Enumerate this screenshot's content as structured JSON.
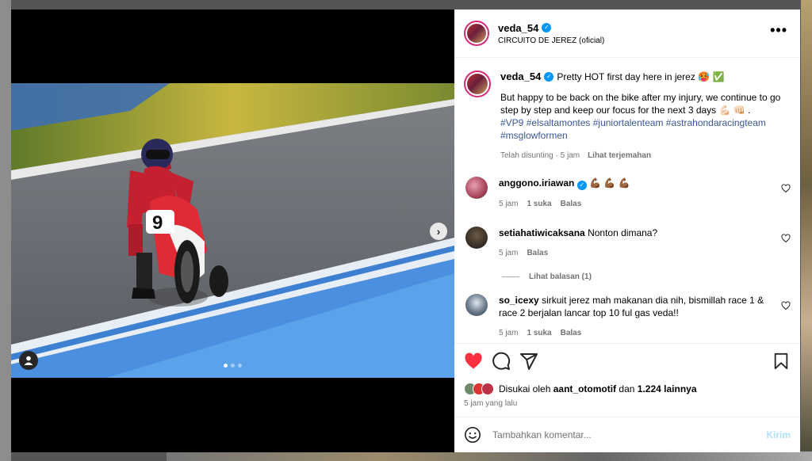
{
  "post": {
    "author": "veda_54",
    "location": "CIRCUITO DE JEREZ (oficial)",
    "more_label": "•••",
    "carousel": {
      "pages": 3,
      "current": 1
    }
  },
  "caption": {
    "author": "veda_54",
    "first_line": "Pretty HOT first day here in jerez 🥵 ✅",
    "body": "But happy to be back on the bike after my injury, we continue to go step by step and keep our focus for the next 3 days 💪🏻 👊🏻 .",
    "hashtags": "#VP9 #elsaltamontes #juniortalenteam #astrahondaracingteam #msglowformen",
    "edited": "Telah disunting · 5 jam",
    "translate": "Lihat terjemahan"
  },
  "comments": [
    {
      "user": "anggono.iriawan",
      "verified": true,
      "text": "💪🏾 💪🏾 💪🏾",
      "time": "5 jam",
      "likes": "1 suka",
      "reply": "Balas",
      "avatar_color": "#a8445a"
    },
    {
      "user": "setiahatiwicaksana",
      "verified": false,
      "text": "Nonton dimana?",
      "time": "5 jam",
      "likes": "",
      "reply": "Balas",
      "avatar_color": "#3a3128"
    },
    {
      "user": "so_icexy",
      "verified": false,
      "text": "sirkuit jerez mah makanan dia nih, bismillah race 1 & race 2 berjalan lancar top 10 ful gas veda!!",
      "time": "5 jam",
      "likes": "1 suka",
      "reply": "Balas",
      "avatar_color": "#6a7a8a"
    }
  ],
  "view_replies": "Lihat balasan (1)",
  "likes": {
    "prefix": "Disukai oleh",
    "user": "aant_otomotif",
    "joiner": "dan",
    "others": "1.224 lainnya",
    "avatar_colors": [
      "#6a8a6a",
      "#d33",
      "#b34"
    ]
  },
  "time_ago": "5 jam yang lalu",
  "composer": {
    "placeholder": "Tambahkan komentar...",
    "post_label": "Kirim"
  },
  "colors": {
    "like_red": "#ff3040",
    "link_blue": "#385898",
    "verified_blue": "#0095f6"
  }
}
